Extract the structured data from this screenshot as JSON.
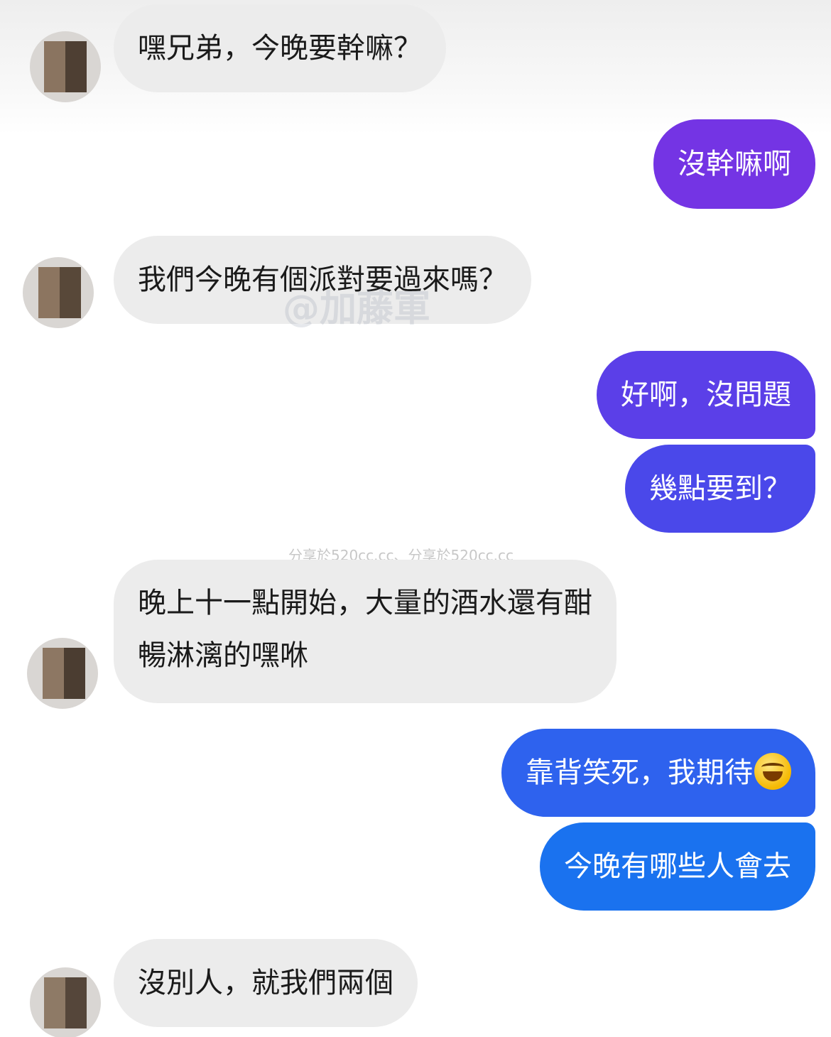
{
  "messages": [
    {
      "side": "incoming",
      "text": "嘿兄弟，今晚要幹嘛？"
    },
    {
      "side": "outgoing",
      "text": "沒幹嘛啊"
    },
    {
      "side": "incoming",
      "text": "我們今晚有個派對要過來嗎？"
    },
    {
      "side": "outgoing",
      "text": "好啊，沒問題"
    },
    {
      "side": "outgoing",
      "text": "幾點要到？"
    },
    {
      "side": "incoming",
      "line1": "晚上十一點開始，大量的酒水還有酣",
      "line2": "暢淋漓的嘿咻"
    },
    {
      "side": "outgoing",
      "text": "靠背笑死，我期待",
      "emoji": "grinning-squinting-face"
    },
    {
      "side": "outgoing",
      "text": "今晚有哪些人會去"
    },
    {
      "side": "incoming",
      "text": "沒別人，就我們兩個"
    }
  ],
  "watermarks": {
    "handle": "@加藤軍",
    "share": "分享於520cc.cc、分享於520cc.cc"
  },
  "colors": {
    "incoming_bubble": "#ececec",
    "outgoing_top": "#7b35e6",
    "outgoing_bottom": "#0d6ff0"
  }
}
